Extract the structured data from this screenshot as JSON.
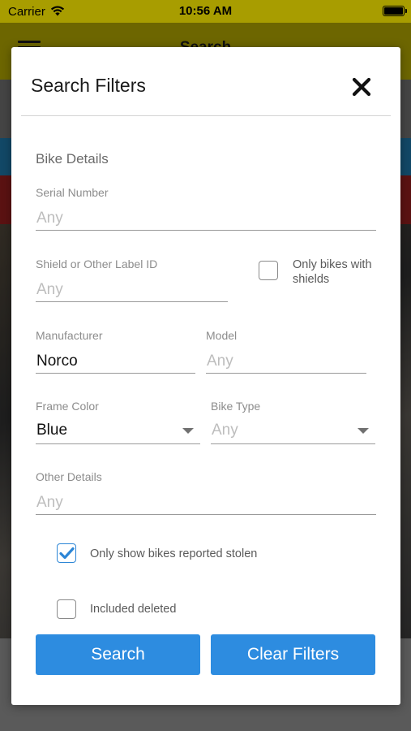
{
  "status_bar": {
    "carrier": "Carrier",
    "time": "10:56 AM"
  },
  "background": {
    "title": "Search"
  },
  "modal": {
    "title": "Search Filters",
    "section_title": "Bike Details",
    "serial_number": {
      "label": "Serial Number",
      "placeholder": "Any",
      "value": ""
    },
    "shield_label_id": {
      "label": "Shield or Other Label ID",
      "placeholder": "Any",
      "value": ""
    },
    "only_shields": {
      "label": "Only bikes with shields",
      "checked": false
    },
    "manufacturer": {
      "label": "Manufacturer",
      "placeholder": "Any",
      "value": "Norco"
    },
    "model": {
      "label": "Model",
      "placeholder": "Any",
      "value": ""
    },
    "frame_color": {
      "label": "Frame Color",
      "value": "Blue"
    },
    "bike_type": {
      "label": "Bike Type",
      "value": "Any"
    },
    "other_details": {
      "label": "Other Details",
      "placeholder": "Any",
      "value": ""
    },
    "only_stolen": {
      "label": "Only show bikes reported stolen",
      "checked": true
    },
    "include_deleted": {
      "label": "Included deleted",
      "checked": false
    },
    "search_button": "Search",
    "clear_button": "Clear Filters"
  },
  "colors": {
    "accent": "#2d8ce0",
    "header_yellow": "#a89d00"
  },
  "icons": {
    "close": "close-icon",
    "checkmark": "checkmark-icon",
    "wifi": "wifi-icon",
    "battery": "battery-icon",
    "menu": "hamburger-menu-icon",
    "dropdown": "chevron-down-icon"
  }
}
